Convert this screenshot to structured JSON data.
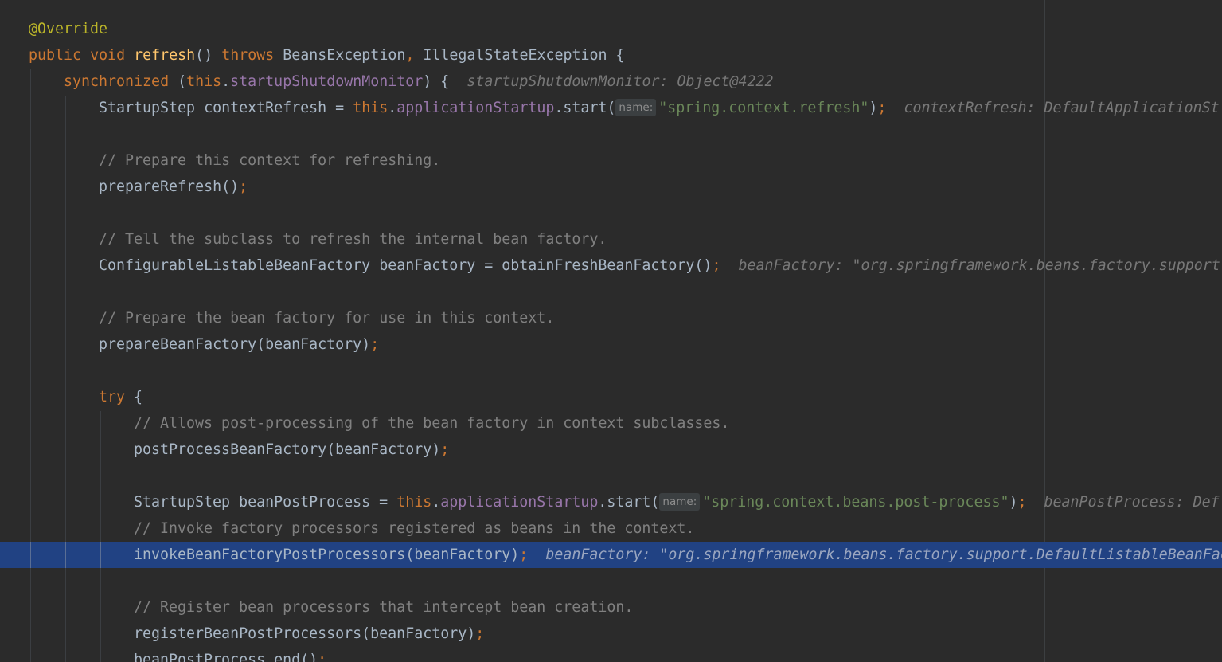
{
  "editor": {
    "lines": {
      "l1": {
        "annotation": "@Override"
      },
      "l2": {
        "kw_public": "public",
        "kw_void": "void",
        "method": "refresh",
        "parens": "()",
        "kw_throws": "throws",
        "ex1": "BeansException",
        "comma": ",",
        "ex2": "IllegalStateException {"
      },
      "l3": {
        "kw_sync": "synchronized",
        "open": "(",
        "kw_this": "this",
        "dot": ".",
        "field": "startupShutdownMonitor",
        "close": ") {",
        "debug": "startupShutdownMonitor: Object@4222"
      },
      "l4": {
        "type_decl": "StartupStep contextRefresh = ",
        "kw_this": "this",
        "dot": ".",
        "field": "applicationStartup",
        "call": ".start(",
        "hint": "name:",
        "string": "\"spring.context.refresh\"",
        "close": ")",
        "semi": ";",
        "debug": "contextRefresh: DefaultApplicationSt"
      },
      "l6": {
        "comment": "// Prepare this context for refreshing."
      },
      "l7": {
        "code": "prepareRefresh()",
        "semi": ";"
      },
      "l9": {
        "comment": "// Tell the subclass to refresh the internal bean factory."
      },
      "l10": {
        "code": "ConfigurableListableBeanFactory beanFactory = obtainFreshBeanFactory()",
        "semi": ";",
        "debug": "beanFactory: \"org.springframework.beans.factory.support"
      },
      "l12": {
        "comment": "// Prepare the bean factory for use in this context."
      },
      "l13": {
        "code": "prepareBeanFactory(beanFactory)",
        "semi": ";"
      },
      "l15": {
        "kw_try": "try",
        "brace": "{"
      },
      "l16": {
        "comment": "// Allows post-processing of the bean factory in context subclasses."
      },
      "l17": {
        "code": "postProcessBeanFactory(beanFactory)",
        "semi": ";"
      },
      "l19": {
        "type_decl": "StartupStep beanPostProcess = ",
        "kw_this": "this",
        "dot": ".",
        "field": "applicationStartup",
        "call": ".start(",
        "hint": "name:",
        "string": "\"spring.context.beans.post-process\"",
        "close": ")",
        "semi": ";",
        "debug": "beanPostProcess: Def"
      },
      "l20": {
        "comment": "// Invoke factory processors registered as beans in the context."
      },
      "l21": {
        "code": "invokeBeanFactoryPostProcessors(beanFactory)",
        "semi": ";",
        "debug": "beanFactory: \"org.springframework.beans.factory.support.DefaultListableBeanFac"
      },
      "l23": {
        "comment": "// Register bean processors that intercept bean creation."
      },
      "l24": {
        "code": "registerBeanPostProcessors(beanFactory)",
        "semi": ";"
      },
      "l25": {
        "code": "beanPostProcess.end()",
        "semi": ";"
      }
    }
  },
  "colors": {
    "background": "#2b2b2b",
    "current_line": "#214283",
    "keyword": "#cc7832",
    "annotation": "#bbb529",
    "method_decl": "#ffc66d",
    "field": "#9876aa",
    "string": "#6a8759",
    "comment": "#808080",
    "default_text": "#a9b7c6"
  }
}
